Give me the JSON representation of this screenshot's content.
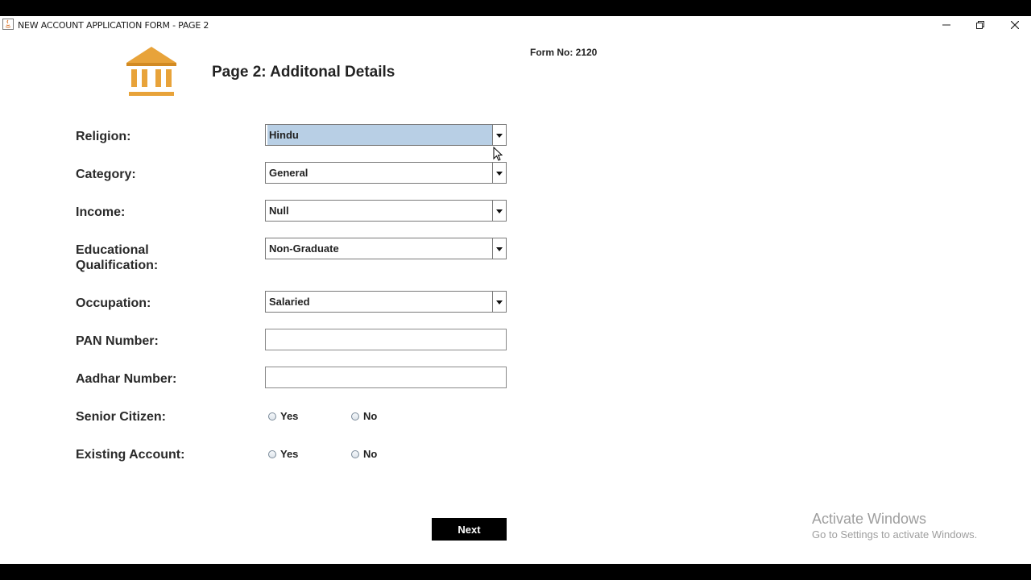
{
  "window": {
    "title": "NEW ACCOUNT APPLICATION FORM - PAGE 2"
  },
  "header": {
    "page_title": "Page 2: Additonal Details",
    "form_no": "Form No: 2120",
    "logo_icon": "bank-icon"
  },
  "fields": {
    "religion": {
      "label": "Religion:",
      "value": "Hindu"
    },
    "category": {
      "label": "Category:",
      "value": "General"
    },
    "income": {
      "label": "Income:",
      "value": "Null"
    },
    "education": {
      "label_line1": "Educational",
      "label_line2": "Qualification:",
      "value": "Non-Graduate"
    },
    "occupation": {
      "label": "Occupation:",
      "value": "Salaried"
    },
    "pan": {
      "label": "PAN Number:",
      "value": ""
    },
    "aadhar": {
      "label": "Aadhar Number:",
      "value": ""
    },
    "senior_citizen": {
      "label": "Senior Citizen:",
      "yes": "Yes",
      "no": "No"
    },
    "existing_account": {
      "label": "Existing Account:",
      "yes": "Yes",
      "no": "No"
    }
  },
  "buttons": {
    "next": "Next"
  },
  "watermark": {
    "line1": "Activate Windows",
    "line2": "Go to Settings to activate Windows."
  },
  "colors": {
    "logo": "#e8a33a",
    "selection": "#b8cfe5"
  }
}
